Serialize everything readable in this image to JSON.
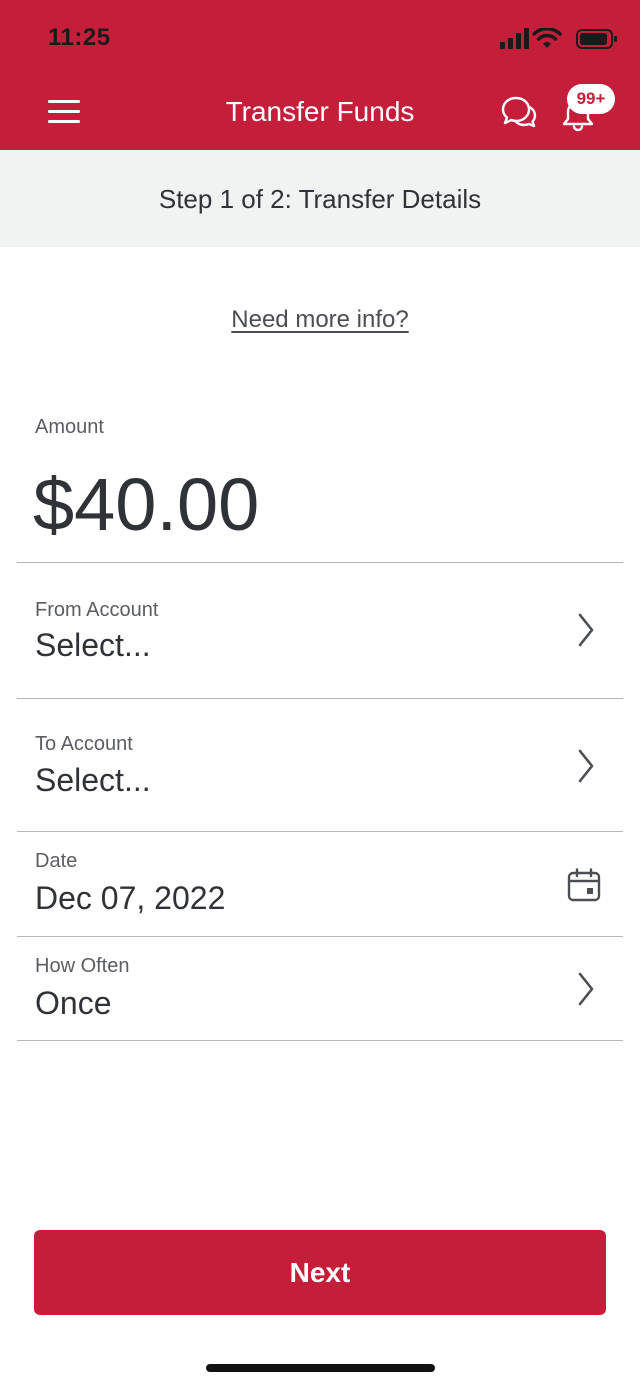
{
  "status_bar": {
    "time": "11:25"
  },
  "header": {
    "title": "Transfer Funds",
    "notification_badge": "99+",
    "brand_color": "#c41e3a"
  },
  "step": {
    "text": "Step 1 of 2: Transfer Details"
  },
  "info_link": "Need more info?",
  "amount": {
    "label": "Amount",
    "value": "$40.00"
  },
  "fields": {
    "from_account": {
      "label": "From Account",
      "value": "Select...",
      "icon": "chevron-right-icon"
    },
    "to_account": {
      "label": "To Account",
      "value": "Select...",
      "icon": "chevron-right-icon"
    },
    "date": {
      "label": "Date",
      "value": "Dec 07, 2022",
      "icon": "calendar-icon"
    },
    "how_often": {
      "label": "How Often",
      "value": "Once",
      "icon": "chevron-right-icon"
    }
  },
  "next_button": {
    "label": "Next"
  }
}
